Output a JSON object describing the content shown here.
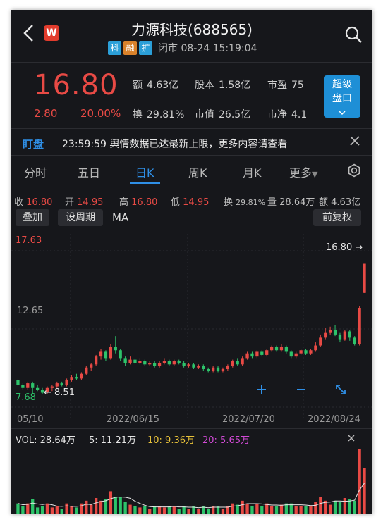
{
  "header": {
    "title": "力源科技(688565)",
    "tags": [
      {
        "t": "科",
        "c": "#2b9fd8"
      },
      {
        "t": "融",
        "c": "#d9822b"
      },
      {
        "t": "扩",
        "c": "#2b9fd8"
      }
    ],
    "status": "闭市 08-24 15:19:04",
    "logo": "W"
  },
  "quote": {
    "price": "16.80",
    "change": "2.80",
    "pct": "20.00%",
    "row1": [
      {
        "l": "额",
        "v": "4.63亿"
      },
      {
        "l": "股本",
        "v": "1.58亿"
      },
      {
        "l": "市盈",
        "v": "75"
      }
    ],
    "row2": [
      {
        "l": "换",
        "v": "29.81%"
      },
      {
        "l": "市值",
        "v": "26.5亿"
      },
      {
        "l": "市净",
        "v": "4.1"
      }
    ],
    "super_btn_line1": "超级",
    "super_btn_line2": "盘口"
  },
  "news": {
    "badge": "盯盘",
    "text": "23:59:59 舆情数据已达最新上限，更多内容请查看"
  },
  "tabs": [
    "分时",
    "五日",
    "日K",
    "周K",
    "月K",
    "更多"
  ],
  "active_tab": 2,
  "ohlc": {
    "close_l": "收",
    "close": "16.80",
    "open_l": "开",
    "open": "14.95",
    "high_l": "高",
    "high": "16.80",
    "low_l": "低",
    "low": "14.95",
    "turn_l": "换",
    "turn": "29.81%",
    "vol_l": "量",
    "vol": "28.64万",
    "amt_l": "额",
    "amt": "4.63亿"
  },
  "toolbar": {
    "overlay": "叠加",
    "period": "设周期",
    "ma": "MA",
    "adjust": "前复权"
  },
  "chart_labels": {
    "high": "17.63",
    "mid": "12.65",
    "low": "7.68",
    "last": "16.80",
    "min_mark": "8.51"
  },
  "dates": [
    "05/10",
    "2022/06/15",
    "2022/07/20",
    "2022/08/24"
  ],
  "volume": {
    "vol_label": "VOL: 28.64万",
    "ma5": "5: 11.21万",
    "ma10": "10: 9.36万",
    "ma20": "20: 5.65万"
  },
  "colors": {
    "up": "#e84a45",
    "down": "#2dc36a",
    "accent": "#2f8fe6",
    "bg": "#16171b"
  },
  "chart_data": {
    "type": "candlestick",
    "ylim": [
      7.68,
      17.63
    ],
    "last_close": 16.8,
    "period_low": 8.51,
    "candles": [
      [
        9.4,
        9.1,
        9.5,
        9.0
      ],
      [
        9.1,
        8.9,
        9.2,
        8.8
      ],
      [
        8.9,
        9.2,
        9.3,
        8.8
      ],
      [
        9.2,
        8.9,
        9.3,
        8.5
      ],
      [
        8.9,
        8.8,
        9.1,
        8.7
      ],
      [
        8.8,
        8.6,
        8.9,
        8.5
      ],
      [
        8.6,
        8.9,
        9.0,
        8.5
      ],
      [
        8.9,
        9.0,
        9.1,
        8.7
      ],
      [
        9.0,
        9.2,
        9.3,
        8.9
      ],
      [
        9.2,
        9.1,
        9.3,
        9.0
      ],
      [
        9.1,
        9.4,
        9.5,
        9.0
      ],
      [
        9.4,
        9.6,
        9.7,
        9.3
      ],
      [
        9.6,
        9.5,
        9.8,
        9.4
      ],
      [
        9.5,
        9.8,
        9.9,
        9.4
      ],
      [
        9.8,
        10.2,
        10.3,
        9.7
      ],
      [
        10.2,
        10.4,
        10.5,
        10.0
      ],
      [
        10.4,
        10.9,
        11.0,
        10.3
      ],
      [
        10.9,
        11.2,
        11.4,
        10.7
      ],
      [
        11.2,
        10.8,
        11.3,
        10.6
      ],
      [
        10.8,
        11.5,
        11.7,
        10.7
      ],
      [
        11.5,
        11.3,
        12.2,
        11.1
      ],
      [
        11.3,
        10.8,
        11.4,
        10.6
      ],
      [
        10.8,
        10.5,
        10.9,
        10.3
      ],
      [
        10.5,
        10.7,
        10.9,
        10.4
      ],
      [
        10.7,
        10.5,
        10.8,
        10.4
      ],
      [
        10.5,
        10.6,
        10.8,
        10.4
      ],
      [
        10.6,
        10.4,
        10.7,
        10.3
      ],
      [
        10.4,
        10.5,
        10.6,
        10.3
      ],
      [
        10.5,
        10.3,
        10.6,
        10.2
      ],
      [
        10.3,
        10.5,
        10.6,
        10.2
      ],
      [
        10.5,
        10.6,
        10.8,
        10.4
      ],
      [
        10.6,
        10.4,
        10.7,
        10.3
      ],
      [
        10.4,
        10.6,
        10.7,
        10.3
      ],
      [
        10.6,
        10.5,
        10.7,
        10.4
      ],
      [
        10.5,
        10.3,
        10.6,
        10.2
      ],
      [
        10.3,
        10.4,
        10.5,
        10.2
      ],
      [
        10.4,
        10.2,
        10.5,
        10.1
      ],
      [
        10.2,
        10.3,
        10.4,
        10.1
      ],
      [
        10.3,
        10.1,
        10.4,
        10.0
      ],
      [
        10.1,
        10.0,
        10.2,
        9.9
      ],
      [
        10.0,
        10.2,
        10.3,
        9.9
      ],
      [
        10.2,
        10.0,
        10.3,
        9.9
      ],
      [
        10.0,
        10.1,
        10.2,
        9.9
      ],
      [
        10.1,
        10.3,
        10.4,
        10.0
      ],
      [
        10.3,
        10.6,
        10.7,
        10.2
      ],
      [
        10.6,
        10.4,
        10.8,
        10.3
      ],
      [
        10.4,
        10.8,
        10.9,
        10.3
      ],
      [
        10.8,
        11.1,
        11.2,
        10.7
      ],
      [
        11.1,
        10.9,
        11.2,
        10.8
      ],
      [
        10.9,
        11.2,
        11.3,
        10.8
      ],
      [
        11.2,
        11.0,
        11.3,
        10.9
      ],
      [
        11.0,
        11.3,
        11.4,
        10.9
      ],
      [
        11.3,
        11.5,
        11.6,
        11.2
      ],
      [
        11.5,
        11.3,
        11.6,
        11.2
      ],
      [
        11.3,
        11.5,
        11.7,
        11.2
      ],
      [
        11.5,
        11.2,
        11.6,
        11.1
      ],
      [
        11.2,
        10.9,
        11.3,
        10.8
      ],
      [
        10.9,
        11.1,
        11.2,
        10.8
      ],
      [
        11.1,
        11.3,
        11.4,
        11.0
      ],
      [
        11.3,
        11.1,
        11.4,
        11.0
      ],
      [
        11.1,
        11.3,
        11.4,
        11.0
      ],
      [
        11.3,
        11.6,
        11.8,
        11.2
      ],
      [
        11.6,
        12.1,
        12.3,
        11.5
      ],
      [
        12.1,
        12.4,
        12.7,
        12.0
      ],
      [
        12.4,
        12.6,
        12.8,
        12.3
      ],
      [
        12.6,
        12.3,
        12.9,
        12.2
      ],
      [
        12.3,
        12.0,
        12.4,
        11.8
      ],
      [
        12.0,
        12.5,
        12.6,
        11.9
      ],
      [
        12.5,
        12.1,
        12.6,
        11.9
      ],
      [
        12.1,
        11.7,
        12.2,
        11.6
      ],
      [
        11.7,
        14.0,
        14.1,
        11.6
      ],
      [
        14.95,
        16.8,
        16.8,
        14.95
      ]
    ]
  }
}
